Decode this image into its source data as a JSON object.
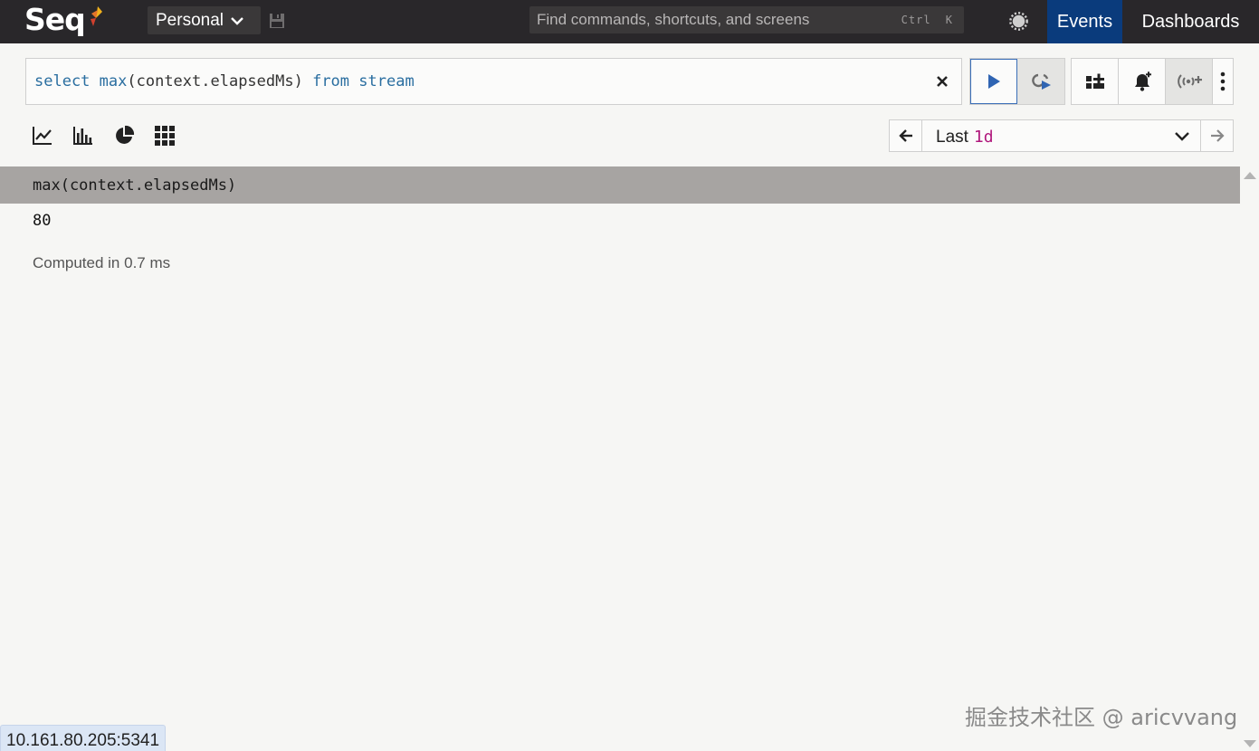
{
  "app": {
    "logo_text": "Seq",
    "workspace": "Personal",
    "command_search_placeholder": "Find commands, shortcuts, and screens",
    "command_shortcut": "Ctrl K",
    "nav": {
      "events": "Events",
      "dashboards": "Dashboards"
    }
  },
  "query": {
    "tokens": [
      "select ",
      "max",
      "(context.elapsedMs) ",
      "from ",
      "stream"
    ]
  },
  "timerange": {
    "prefix": "Last",
    "value": "1d"
  },
  "results": {
    "columns": [
      "max(context.elapsedMs)"
    ],
    "rows": [
      [
        "80"
      ]
    ],
    "computed": "Computed in 0.7 ms"
  },
  "status": {
    "url": "10.161.80.205:5341"
  },
  "watermark": "掘金技术社区 @ aricvvang",
  "colors": {
    "topbar": "#29272a",
    "events_active": "#0a3b7c",
    "result_header": "#a7a4a2",
    "time_value": "#b0177c",
    "query_keyword": "#2a6ea0"
  },
  "icons": [
    "seq-logo-icon",
    "chevron-down-icon",
    "save-icon",
    "theme-toggle-icon",
    "clear-icon",
    "run-icon",
    "refresh-icon",
    "add-to-dashboard-icon",
    "add-alert-icon",
    "add-signal-icon",
    "more-icon",
    "line-chart-icon",
    "bar-chart-icon",
    "pie-chart-icon",
    "grid-icon",
    "arrow-left-icon",
    "arrow-right-icon"
  ]
}
